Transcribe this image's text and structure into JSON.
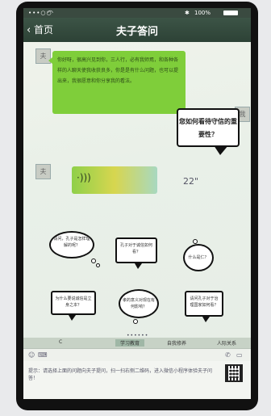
{
  "status_bar": {
    "signal": "•••○○",
    "battery_text": "100%"
  },
  "header": {
    "back_label": "首页",
    "title": "夫子答问"
  },
  "messages": {
    "greeting": "你好呀，很高兴见到你，三人行，必有我师焉，和各种各样的人聊天使我收获良多，你是是有什么问题，也可以提出来，我很愿意和你分享我的看法。",
    "user_question": "您如何看待守信的重要性？",
    "voice_duration": "22\""
  },
  "templates": [
    {
      "text": "请问，孔子是怎样理解的呢？"
    },
    {
      "text": "孔子对于诚信如何看？"
    },
    {
      "text": "什么是仁？"
    },
    {
      "text": "为什么要说诚信是立身之本？"
    },
    {
      "text": "孝的意义对现在有何影响？"
    },
    {
      "text": "请问孔子对于治理国家如何看？"
    }
  ],
  "pager": "••••••",
  "tabs": {
    "items": [
      "C",
      "学习教育",
      "自我修养",
      "人际关系"
    ],
    "active_index": 1
  },
  "tip": {
    "text": "提示：请选择上面的问题向夫子提问，扫一扫右侧二维码，进入微信小程序体验夫子问答！"
  },
  "colors": {
    "header_bg": "#2d4236",
    "bubble_green": "#7fce3a",
    "tab_active": "#9fb7a6"
  },
  "icons": {
    "back": "chevron-left-icon",
    "voice": "voice-wave-icon",
    "emoji": "emoji-icon",
    "keyboard": "keyboard-icon",
    "phone": "phone-icon",
    "more": "more-icon"
  }
}
